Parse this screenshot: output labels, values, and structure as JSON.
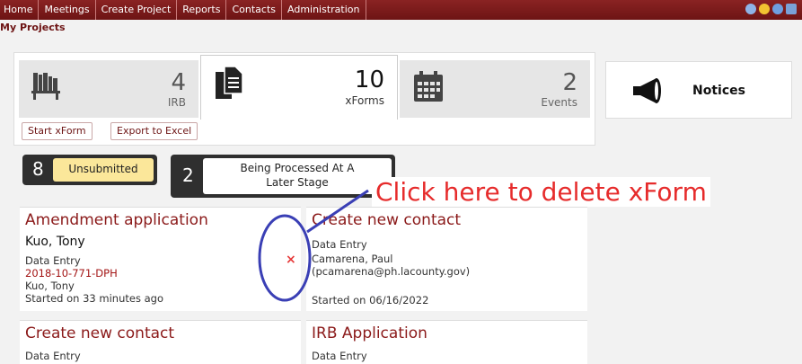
{
  "nav": {
    "items": [
      "Home",
      "Meetings",
      "Create Project",
      "Reports",
      "Contacts",
      "Administration"
    ]
  },
  "page_title": "My Projects",
  "stats": [
    {
      "count": "4",
      "label": "IRB",
      "icon": "books-icon"
    },
    {
      "count": "10",
      "label": "xForms",
      "icon": "documents-icon"
    },
    {
      "count": "2",
      "label": "Events",
      "icon": "calendar-icon"
    }
  ],
  "buttons": {
    "start_xform": "Start xForm",
    "export_excel": "Export to Excel"
  },
  "notices": {
    "title": "Notices"
  },
  "status": {
    "unsubmitted": {
      "count": "8",
      "label": "Unsubmitted"
    },
    "processing": {
      "count": "2",
      "label_line1": "Being Processed At A",
      "label_line2": "Later Stage"
    }
  },
  "cards": [
    {
      "title": "Amendment application",
      "name": "Kuo, Tony",
      "type": "Data Entry",
      "ref": "2018-10-771-DPH",
      "person": "Kuo, Tony",
      "started": "Started on 33 minutes ago"
    },
    {
      "title": "Create new contact",
      "type": "Data Entry",
      "person": "Camarena, Paul",
      "email": "(pcamarena@ph.lacounty.gov)",
      "started": "Started on 06/16/2022"
    },
    {
      "title": "Create new contact",
      "type": "Data Entry"
    },
    {
      "title": "IRB Application",
      "type": "Data Entry"
    }
  ],
  "delete_mark": "×",
  "annotation": "Click here to delete xForm",
  "colors": {
    "brand": "#7a1b1b",
    "annotation": "#e62b2b",
    "highlight": "#3a3fb5",
    "pill_yellow": "#fbe79a"
  }
}
